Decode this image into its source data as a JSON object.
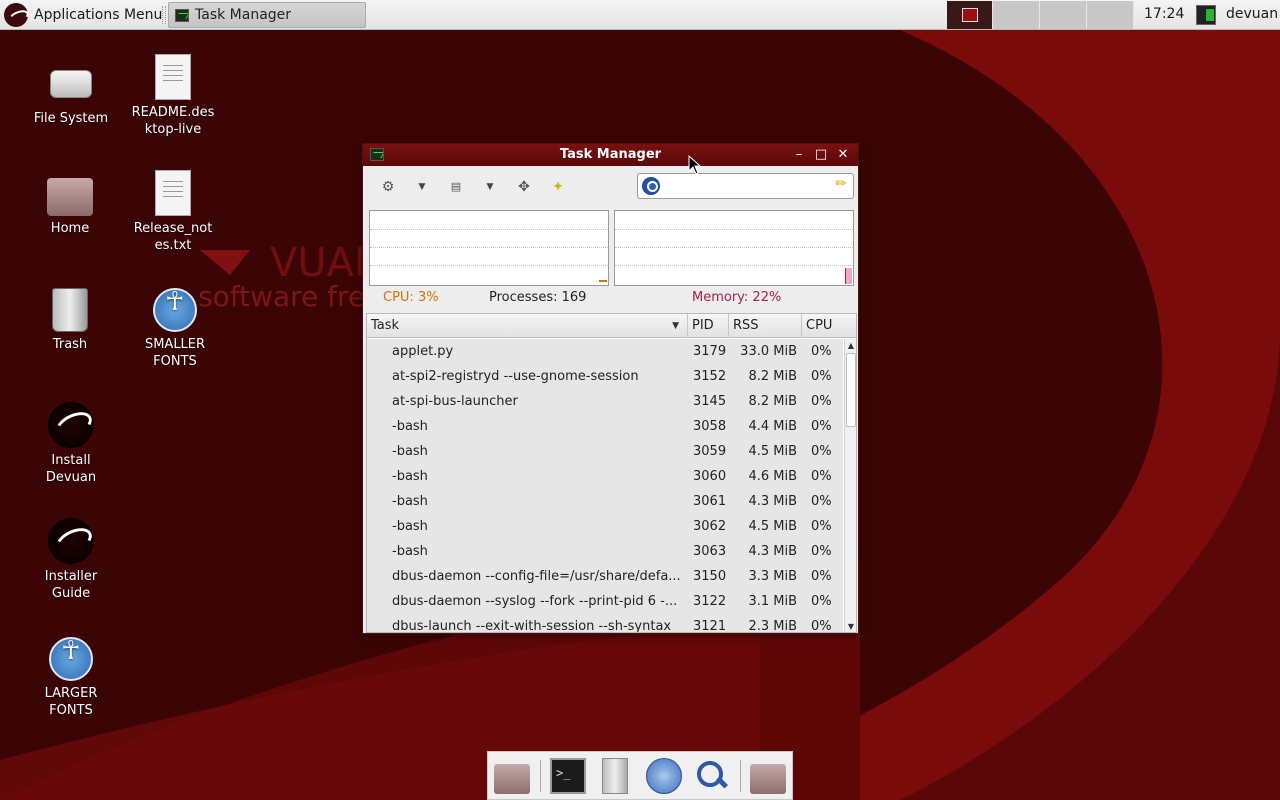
{
  "panel": {
    "apps_menu_label": "Applications Menu",
    "taskbar_item_label": "Task Manager",
    "clock": "17:24",
    "user": "devuan"
  },
  "desktop": {
    "icons": [
      {
        "label": "File System",
        "icon": "drive-icon"
      },
      {
        "label": "README.desktop-live",
        "icon": "document-icon"
      },
      {
        "label": "Home",
        "icon": "home-folder-icon"
      },
      {
        "label": "Release_notes.txt",
        "icon": "document-icon"
      },
      {
        "label": "Trash",
        "icon": "trash-icon"
      },
      {
        "label": "SMALLER FONTS",
        "icon": "accessibility-icon"
      },
      {
        "label": "Install Devuan",
        "icon": "devuan-logo-icon"
      },
      {
        "label": "Installer Guide",
        "icon": "devuan-logo-icon"
      },
      {
        "label": "LARGER FONTS",
        "icon": "accessibility-icon"
      }
    ],
    "wallpaper_text": "software free"
  },
  "task_manager": {
    "title": "Task Manager",
    "search": {
      "value": "",
      "placeholder": ""
    },
    "cpu_label": "CPU: 3%",
    "processes_label": "Processes: 169",
    "memory_label": "Memory: 22%",
    "columns": {
      "task": "Task",
      "pid": "PID",
      "rss": "RSS",
      "cpu": "CPU"
    },
    "rows": [
      {
        "task": "applet.py",
        "pid": "3179",
        "rss": "33.0 MiB",
        "cpu": "0%"
      },
      {
        "task": "at-spi2-registryd --use-gnome-session",
        "pid": "3152",
        "rss": "8.2 MiB",
        "cpu": "0%"
      },
      {
        "task": "at-spi-bus-launcher",
        "pid": "3145",
        "rss": "8.2 MiB",
        "cpu": "0%"
      },
      {
        "task": "-bash",
        "pid": "3058",
        "rss": "4.4 MiB",
        "cpu": "0%"
      },
      {
        "task": "-bash",
        "pid": "3059",
        "rss": "4.5 MiB",
        "cpu": "0%"
      },
      {
        "task": "-bash",
        "pid": "3060",
        "rss": "4.6 MiB",
        "cpu": "0%"
      },
      {
        "task": "-bash",
        "pid": "3061",
        "rss": "4.3 MiB",
        "cpu": "0%"
      },
      {
        "task": "-bash",
        "pid": "3062",
        "rss": "4.5 MiB",
        "cpu": "0%"
      },
      {
        "task": "-bash",
        "pid": "3063",
        "rss": "4.3 MiB",
        "cpu": "0%"
      },
      {
        "task": "dbus-daemon --config-file=/usr/share/defa...",
        "pid": "3150",
        "rss": "3.3 MiB",
        "cpu": "0%"
      },
      {
        "task": "dbus-daemon --syslog --fork --print-pid 6 -...",
        "pid": "3122",
        "rss": "3.1 MiB",
        "cpu": "0%"
      },
      {
        "task": "dbus-launch --exit-with-session --sh-syntax",
        "pid": "3121",
        "rss": "2.3 MiB",
        "cpu": "0%"
      }
    ]
  },
  "dock": {
    "items": [
      "home-folder-icon",
      "terminal-icon",
      "file-cabinet-icon",
      "web-browser-icon",
      "search-icon",
      "folder-icon"
    ]
  },
  "colors": {
    "wallpaper_dark": "#3a0505",
    "wallpaper_red": "#7a0a0a",
    "titlebar": "#6b0c0c",
    "cpu_text": "#e07000",
    "memory_text": "#b01c4c"
  }
}
